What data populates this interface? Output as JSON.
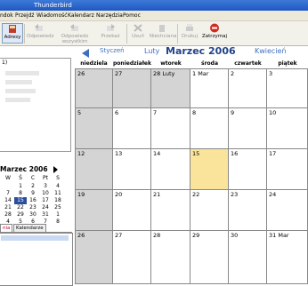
{
  "window": {
    "title": "Thunderbird"
  },
  "menu": [
    "ndok",
    "Przejdź",
    "Wiadomość",
    "Kalendarz",
    "Narzędzia",
    "Pomoc"
  ],
  "toolbar": {
    "addresses": "Adresy",
    "reply": "Odpowiedz",
    "reply_all": "Odpowiedz wszystkim",
    "forward": "Przekaż",
    "delete": "Usuń",
    "junk": "Niechciana",
    "print": "Drukuj",
    "stop": "Zatrzymaj"
  },
  "folder_tree": {
    "visible_fragment": "1)"
  },
  "mini_calendar": {
    "title": "Marzec 2006",
    "days": [
      "W",
      "Ś",
      "C",
      "Pt",
      "S"
    ],
    "rows": [
      [
        "",
        "1",
        "2",
        "3",
        "4"
      ],
      [
        "7",
        "8",
        "9",
        "10",
        "11"
      ],
      [
        "14",
        "15",
        "16",
        "17",
        "18"
      ],
      [
        "21",
        "22",
        "23",
        "24",
        "25"
      ],
      [
        "28",
        "29",
        "30",
        "31",
        "1"
      ],
      [
        "4",
        "5",
        "6",
        "7",
        "8"
      ]
    ],
    "today": "15"
  },
  "tabs": [
    "nia",
    "Kalendarze"
  ],
  "calendar": {
    "prev_month": "Styczeń",
    "prev_month2": "Luty",
    "current": "Marzec 2006",
    "next_month": "Kwiecień",
    "day_headers": [
      "niedziela",
      "poniedziałek",
      "wtorek",
      "środa",
      "czwartek",
      "piątek"
    ],
    "weeks": [
      [
        "26",
        "27",
        "28 Luty",
        "1 Mar",
        "2",
        "3"
      ],
      [
        "5",
        "6",
        "7",
        "8",
        "9",
        "10"
      ],
      [
        "12",
        "13",
        "14",
        "15",
        "16",
        "17"
      ],
      [
        "19",
        "20",
        "21",
        "22",
        "23",
        "24"
      ],
      [
        "26",
        "27",
        "28",
        "29",
        "30",
        "31 Mar"
      ]
    ],
    "today": "15"
  }
}
